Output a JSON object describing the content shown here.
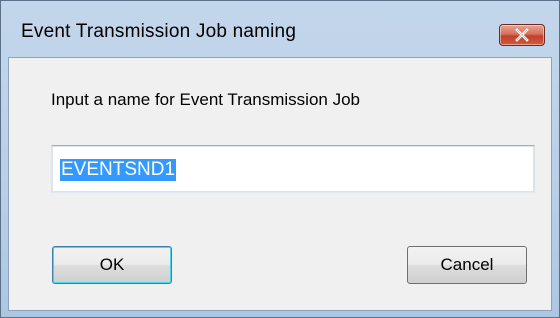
{
  "window": {
    "title": "Event Transmission Job naming"
  },
  "titlebar": {
    "close_icon": "close-x-icon"
  },
  "dialog": {
    "prompt": "Input a name for Event Transmission Job",
    "name_value": "EVENTSND1",
    "ok_label": "OK",
    "cancel_label": "Cancel"
  },
  "colors": {
    "selection": "#3399ff",
    "close_button": "#c7503b",
    "client_bg": "#f0f0f0"
  }
}
